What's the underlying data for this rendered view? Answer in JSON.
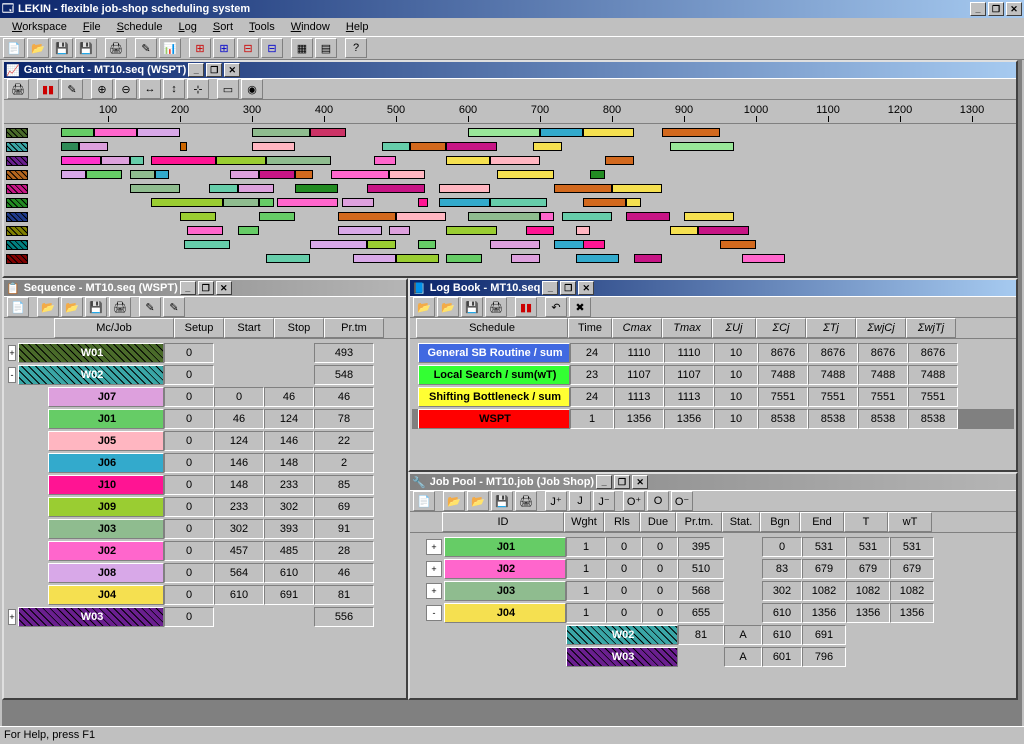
{
  "app": {
    "title": "LEKIN - flexible job-shop scheduling system"
  },
  "menu": [
    "Workspace",
    "File",
    "Schedule",
    "Log",
    "Sort",
    "Tools",
    "Window",
    "Help"
  ],
  "status": "For Help, press F1",
  "gantt": {
    "title": "Gantt Chart - MT10.seq (WSPT)",
    "ticks": [
      100,
      200,
      300,
      400,
      500,
      600,
      700,
      800,
      900,
      1000,
      1100,
      1200,
      1300
    ],
    "machines": [
      {
        "color": "#4a6b2a",
        "hatch": true
      },
      {
        "color": "#3aa6a6",
        "hatch": true
      },
      {
        "color": "#6a1f8f",
        "hatch": true
      },
      {
        "color": "#b5651d",
        "hatch": true
      },
      {
        "color": "#c71585",
        "hatch": true
      },
      {
        "color": "#228b22",
        "hatch": true
      },
      {
        "color": "#1e3a8a",
        "hatch": true
      },
      {
        "color": "#808000",
        "hatch": true
      },
      {
        "color": "#008080",
        "hatch": true
      },
      {
        "color": "#800000",
        "hatch": true
      }
    ],
    "bars": [
      {
        "r": 0,
        "s": 35,
        "e": 80,
        "c": "#66cc66"
      },
      {
        "r": 0,
        "s": 80,
        "e": 140,
        "c": "#ff66cc"
      },
      {
        "r": 0,
        "s": 140,
        "e": 200,
        "c": "#d8a8e8"
      },
      {
        "r": 0,
        "s": 300,
        "e": 380,
        "c": "#8fbc8f"
      },
      {
        "r": 0,
        "s": 380,
        "e": 430,
        "c": "#cc3366"
      },
      {
        "r": 0,
        "s": 600,
        "e": 700,
        "c": "#99e699"
      },
      {
        "r": 0,
        "s": 700,
        "e": 760,
        "c": "#33aacc"
      },
      {
        "r": 0,
        "s": 760,
        "e": 830,
        "c": "#f5e050"
      },
      {
        "r": 0,
        "s": 870,
        "e": 950,
        "c": "#d2691e"
      },
      {
        "r": 1,
        "s": 35,
        "e": 60,
        "c": "#2e8b57"
      },
      {
        "r": 1,
        "s": 60,
        "e": 100,
        "c": "#dda0dd"
      },
      {
        "r": 1,
        "s": 200,
        "e": 210,
        "c": "#cc6600"
      },
      {
        "r": 1,
        "s": 300,
        "e": 360,
        "c": "#ffb6c1"
      },
      {
        "r": 1,
        "s": 480,
        "e": 520,
        "c": "#66cdaa"
      },
      {
        "r": 1,
        "s": 520,
        "e": 570,
        "c": "#d2691e"
      },
      {
        "r": 1,
        "s": 570,
        "e": 640,
        "c": "#c71585"
      },
      {
        "r": 1,
        "s": 690,
        "e": 730,
        "c": "#f5e050"
      },
      {
        "r": 1,
        "s": 880,
        "e": 970,
        "c": "#99e699"
      },
      {
        "r": 2,
        "s": 35,
        "e": 90,
        "c": "#ff33cc"
      },
      {
        "r": 2,
        "s": 90,
        "e": 130,
        "c": "#dda0dd"
      },
      {
        "r": 2,
        "s": 130,
        "e": 150,
        "c": "#66cdaa"
      },
      {
        "r": 2,
        "s": 160,
        "e": 250,
        "c": "#ff1493"
      },
      {
        "r": 2,
        "s": 250,
        "e": 320,
        "c": "#9acd32"
      },
      {
        "r": 2,
        "s": 320,
        "e": 410,
        "c": "#8fbc8f"
      },
      {
        "r": 2,
        "s": 470,
        "e": 500,
        "c": "#ff66cc"
      },
      {
        "r": 2,
        "s": 570,
        "e": 630,
        "c": "#f5e050"
      },
      {
        "r": 2,
        "s": 630,
        "e": 700,
        "c": "#ffb6c1"
      },
      {
        "r": 2,
        "s": 790,
        "e": 830,
        "c": "#d2691e"
      },
      {
        "r": 3,
        "s": 35,
        "e": 70,
        "c": "#d8a8e8"
      },
      {
        "r": 3,
        "s": 70,
        "e": 120,
        "c": "#66cc66"
      },
      {
        "r": 3,
        "s": 130,
        "e": 165,
        "c": "#8fbc8f"
      },
      {
        "r": 3,
        "s": 165,
        "e": 185,
        "c": "#33aacc"
      },
      {
        "r": 3,
        "s": 270,
        "e": 310,
        "c": "#dda0dd"
      },
      {
        "r": 3,
        "s": 310,
        "e": 360,
        "c": "#c71585"
      },
      {
        "r": 3,
        "s": 360,
        "e": 385,
        "c": "#d2691e"
      },
      {
        "r": 3,
        "s": 410,
        "e": 490,
        "c": "#ff66cc"
      },
      {
        "r": 3,
        "s": 490,
        "e": 540,
        "c": "#ffb6c1"
      },
      {
        "r": 3,
        "s": 640,
        "e": 720,
        "c": "#f5e050"
      },
      {
        "r": 3,
        "s": 770,
        "e": 790,
        "c": "#228b22"
      },
      {
        "r": 4,
        "s": 130,
        "e": 200,
        "c": "#8fbc8f"
      },
      {
        "r": 4,
        "s": 240,
        "e": 280,
        "c": "#66cdaa"
      },
      {
        "r": 4,
        "s": 280,
        "e": 330,
        "c": "#dda0dd"
      },
      {
        "r": 4,
        "s": 360,
        "e": 420,
        "c": "#228b22"
      },
      {
        "r": 4,
        "s": 460,
        "e": 540,
        "c": "#c71585"
      },
      {
        "r": 4,
        "s": 560,
        "e": 630,
        "c": "#ffb6c1"
      },
      {
        "r": 4,
        "s": 720,
        "e": 800,
        "c": "#d2691e"
      },
      {
        "r": 4,
        "s": 800,
        "e": 870,
        "c": "#f5e050"
      },
      {
        "r": 5,
        "s": 160,
        "e": 260,
        "c": "#9acd32"
      },
      {
        "r": 5,
        "s": 260,
        "e": 310,
        "c": "#8fbc8f"
      },
      {
        "r": 5,
        "s": 310,
        "e": 330,
        "c": "#66cc66"
      },
      {
        "r": 5,
        "s": 335,
        "e": 420,
        "c": "#ff66cc"
      },
      {
        "r": 5,
        "s": 425,
        "e": 470,
        "c": "#dda0dd"
      },
      {
        "r": 5,
        "s": 530,
        "e": 545,
        "c": "#ff1493"
      },
      {
        "r": 5,
        "s": 560,
        "e": 630,
        "c": "#33aacc"
      },
      {
        "r": 5,
        "s": 630,
        "e": 710,
        "c": "#66cdaa"
      },
      {
        "r": 5,
        "s": 760,
        "e": 820,
        "c": "#d2691e"
      },
      {
        "r": 5,
        "s": 820,
        "e": 840,
        "c": "#f5e050"
      },
      {
        "r": 6,
        "s": 200,
        "e": 250,
        "c": "#9acd32"
      },
      {
        "r": 6,
        "s": 310,
        "e": 360,
        "c": "#66cc66"
      },
      {
        "r": 6,
        "s": 420,
        "e": 500,
        "c": "#d2691e"
      },
      {
        "r": 6,
        "s": 500,
        "e": 570,
        "c": "#ffb6c1"
      },
      {
        "r": 6,
        "s": 600,
        "e": 700,
        "c": "#8fbc8f"
      },
      {
        "r": 6,
        "s": 700,
        "e": 720,
        "c": "#ff66cc"
      },
      {
        "r": 6,
        "s": 730,
        "e": 800,
        "c": "#66cdaa"
      },
      {
        "r": 6,
        "s": 820,
        "e": 880,
        "c": "#c71585"
      },
      {
        "r": 6,
        "s": 900,
        "e": 970,
        "c": "#f5e050"
      },
      {
        "r": 7,
        "s": 210,
        "e": 260,
        "c": "#ff66cc"
      },
      {
        "r": 7,
        "s": 280,
        "e": 310,
        "c": "#66cc66"
      },
      {
        "r": 7,
        "s": 420,
        "e": 480,
        "c": "#d8a8e8"
      },
      {
        "r": 7,
        "s": 490,
        "e": 520,
        "c": "#dda0dd"
      },
      {
        "r": 7,
        "s": 570,
        "e": 640,
        "c": "#9acd32"
      },
      {
        "r": 7,
        "s": 680,
        "e": 720,
        "c": "#ff1493"
      },
      {
        "r": 7,
        "s": 750,
        "e": 770,
        "c": "#ffb6c1"
      },
      {
        "r": 7,
        "s": 880,
        "e": 920,
        "c": "#f5e050"
      },
      {
        "r": 7,
        "s": 920,
        "e": 990,
        "c": "#c71585"
      },
      {
        "r": 8,
        "s": 205,
        "e": 270,
        "c": "#66cdaa"
      },
      {
        "r": 8,
        "s": 380,
        "e": 460,
        "c": "#d8a8e8"
      },
      {
        "r": 8,
        "s": 460,
        "e": 500,
        "c": "#9acd32"
      },
      {
        "r": 8,
        "s": 530,
        "e": 555,
        "c": "#66cc66"
      },
      {
        "r": 8,
        "s": 630,
        "e": 700,
        "c": "#dda0dd"
      },
      {
        "r": 8,
        "s": 720,
        "e": 770,
        "c": "#33aacc"
      },
      {
        "r": 8,
        "s": 760,
        "e": 790,
        "c": "#ff1493"
      },
      {
        "r": 8,
        "s": 950,
        "e": 1000,
        "c": "#d2691e"
      },
      {
        "r": 9,
        "s": 320,
        "e": 380,
        "c": "#66cdaa"
      },
      {
        "r": 9,
        "s": 440,
        "e": 500,
        "c": "#d8a8e8"
      },
      {
        "r": 9,
        "s": 500,
        "e": 560,
        "c": "#9acd32"
      },
      {
        "r": 9,
        "s": 570,
        "e": 620,
        "c": "#66cc66"
      },
      {
        "r": 9,
        "s": 660,
        "e": 700,
        "c": "#dda0dd"
      },
      {
        "r": 9,
        "s": 750,
        "e": 810,
        "c": "#33aacc"
      },
      {
        "r": 9,
        "s": 830,
        "e": 870,
        "c": "#c71585"
      },
      {
        "r": 9,
        "s": 980,
        "e": 1040,
        "c": "#ff66cc"
      }
    ]
  },
  "sequence": {
    "title": "Sequence - MT10.seq (WSPT)",
    "headers": [
      "Mc/Job",
      "Setup",
      "Start",
      "Stop",
      "Pr.tm"
    ],
    "rows": [
      {
        "indent": 0,
        "toggle": "+",
        "label": "W01",
        "bg": "#4a6b2a",
        "hatch": true,
        "vals": [
          "0",
          "",
          "",
          "493"
        ]
      },
      {
        "indent": 0,
        "toggle": "-",
        "label": "W02",
        "bg": "#3aa6a6",
        "hatch": true,
        "vals": [
          "0",
          "",
          "",
          "548"
        ]
      },
      {
        "indent": 1,
        "label": "J07",
        "bg": "#dda0dd",
        "vals": [
          "0",
          "0",
          "46",
          "46"
        ]
      },
      {
        "indent": 1,
        "label": "J01",
        "bg": "#66cc66",
        "vals": [
          "0",
          "46",
          "124",
          "78"
        ]
      },
      {
        "indent": 1,
        "label": "J05",
        "bg": "#ffb6c1",
        "vals": [
          "0",
          "124",
          "146",
          "22"
        ]
      },
      {
        "indent": 1,
        "label": "J06",
        "bg": "#33aacc",
        "vals": [
          "0",
          "146",
          "148",
          "2"
        ]
      },
      {
        "indent": 1,
        "label": "J10",
        "bg": "#ff1493",
        "vals": [
          "0",
          "148",
          "233",
          "85"
        ]
      },
      {
        "indent": 1,
        "label": "J09",
        "bg": "#9acd32",
        "vals": [
          "0",
          "233",
          "302",
          "69"
        ]
      },
      {
        "indent": 1,
        "label": "J03",
        "bg": "#8fbc8f",
        "vals": [
          "0",
          "302",
          "393",
          "91"
        ]
      },
      {
        "indent": 1,
        "label": "J02",
        "bg": "#ff66cc",
        "vals": [
          "0",
          "457",
          "485",
          "28"
        ]
      },
      {
        "indent": 1,
        "label": "J08",
        "bg": "#d8a8e8",
        "vals": [
          "0",
          "564",
          "610",
          "46"
        ]
      },
      {
        "indent": 1,
        "label": "J04",
        "bg": "#f5e050",
        "vals": [
          "0",
          "610",
          "691",
          "81"
        ]
      },
      {
        "indent": 0,
        "toggle": "+",
        "label": "W03",
        "bg": "#6a1f8f",
        "hatch": true,
        "vals": [
          "0",
          "",
          "",
          "556"
        ]
      }
    ]
  },
  "logbook": {
    "title": "Log Book - MT10.seq",
    "headers": [
      "Schedule",
      "Time",
      "Cmax",
      "Tmax",
      "ΣUj",
      "ΣCj",
      "ΣTj",
      "ΣwjCj",
      "ΣwjTj"
    ],
    "rows": [
      {
        "label": "General SB Routine / sum",
        "bg": "#4169e1",
        "fg": "#ffffff",
        "vals": [
          "24",
          "1110",
          "1110",
          "10",
          "8676",
          "8676",
          "8676",
          "8676"
        ]
      },
      {
        "label": "Local Search / sum(wT)",
        "bg": "#33ff33",
        "fg": "#000000",
        "vals": [
          "23",
          "1107",
          "1107",
          "10",
          "7488",
          "7488",
          "7488",
          "7488"
        ]
      },
      {
        "label": "Shifting Bottleneck / sum",
        "bg": "#ffff33",
        "fg": "#000000",
        "vals": [
          "24",
          "1113",
          "1113",
          "10",
          "7551",
          "7551",
          "7551",
          "7551"
        ]
      },
      {
        "label": "WSPT",
        "bg": "#ff0000",
        "fg": "#000000",
        "sel": true,
        "vals": [
          "1",
          "1356",
          "1356",
          "10",
          "8538",
          "8538",
          "8538",
          "8538"
        ]
      }
    ]
  },
  "jobpool": {
    "title": "Job Pool - MT10.job (Job Shop)",
    "headers": [
      "ID",
      "Wght",
      "Rls",
      "Due",
      "Pr.tm.",
      "Stat.",
      "Bgn",
      "End",
      "T",
      "wT"
    ],
    "rows": [
      {
        "toggle": "+",
        "label": "J01",
        "bg": "#66cc66",
        "vals": [
          "1",
          "0",
          "0",
          "395",
          "",
          "0",
          "531",
          "531",
          "531"
        ]
      },
      {
        "toggle": "+",
        "label": "J02",
        "bg": "#ff66cc",
        "vals": [
          "1",
          "0",
          "0",
          "510",
          "",
          "83",
          "679",
          "679",
          "679"
        ]
      },
      {
        "toggle": "+",
        "label": "J03",
        "bg": "#8fbc8f",
        "vals": [
          "1",
          "0",
          "0",
          "568",
          "",
          "302",
          "1082",
          "1082",
          "1082"
        ]
      },
      {
        "toggle": "-",
        "label": "J04",
        "bg": "#f5e050",
        "vals": [
          "1",
          "0",
          "0",
          "655",
          "",
          "610",
          "1356",
          "1356",
          "1356"
        ]
      },
      {
        "sub": true,
        "label": "W02",
        "bg": "#3aa6a6",
        "hatch": true,
        "vals": [
          "",
          "",
          "",
          "81",
          "A",
          "610",
          "691",
          "",
          ""
        ]
      },
      {
        "sub": true,
        "label": "W03",
        "bg": "#6a1f8f",
        "hatch": true,
        "vals": [
          "",
          "",
          "",
          "",
          "A",
          "601",
          "796",
          "",
          ""
        ]
      }
    ]
  }
}
